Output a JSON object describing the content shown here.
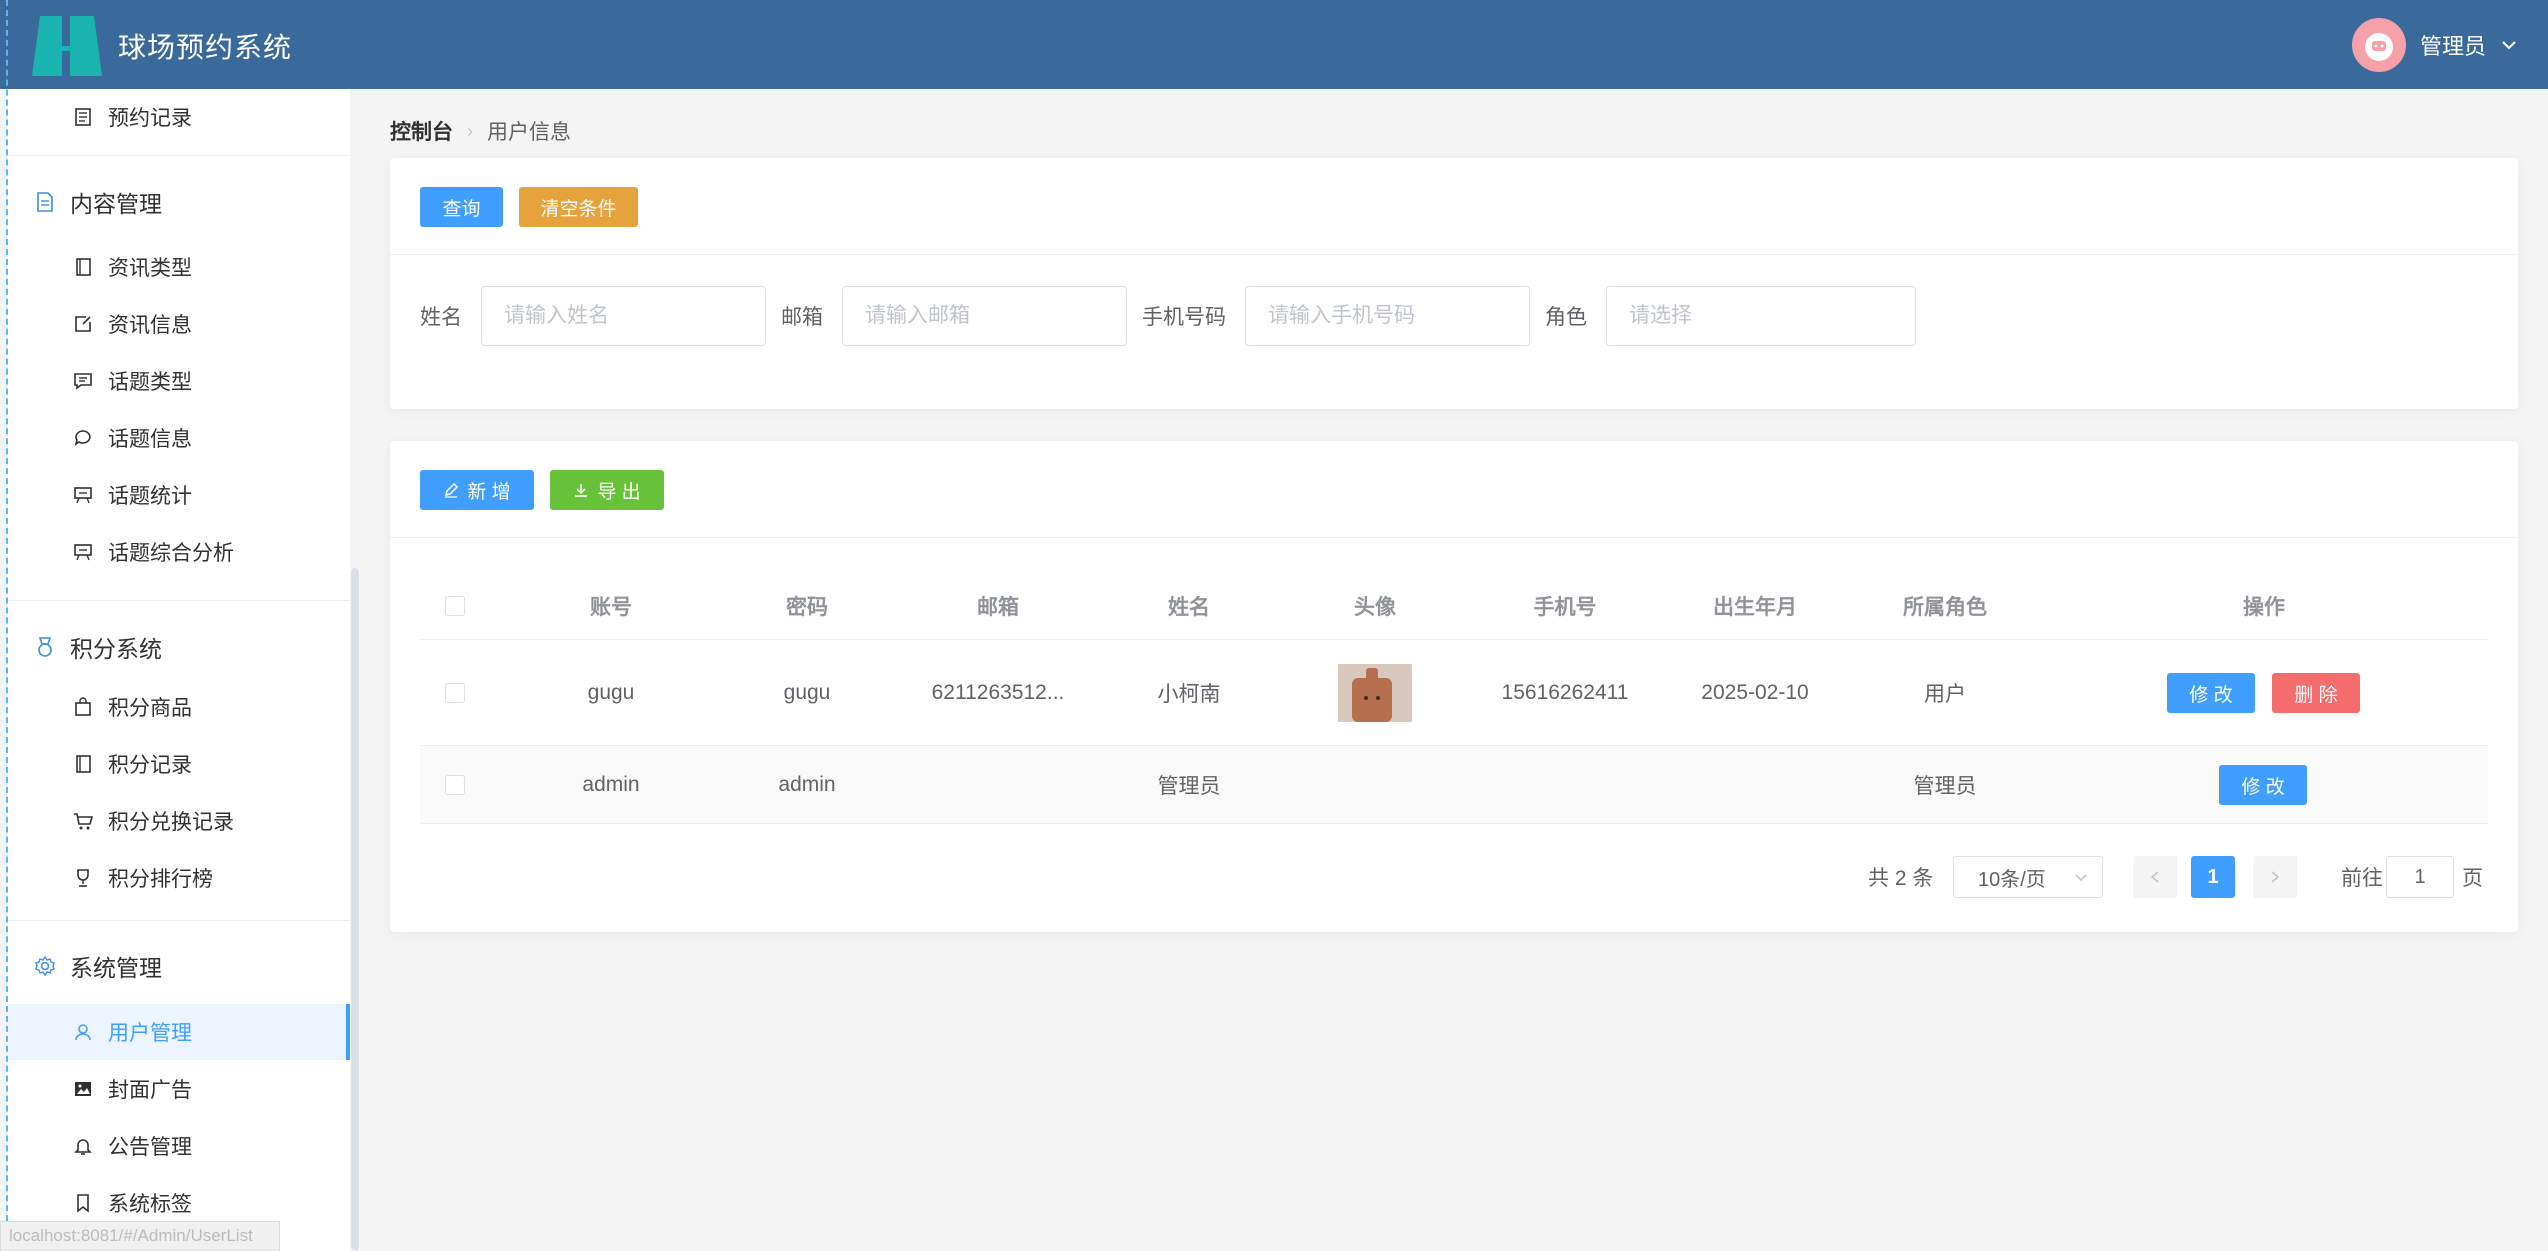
{
  "header": {
    "app_title": "球场预约系统",
    "user_label": "管理员"
  },
  "sidebar": {
    "items": [
      {
        "label": "预约记录",
        "icon": "document-icon"
      },
      {
        "label": "内容管理",
        "icon": "file-text-icon",
        "group": true
      },
      {
        "label": "资讯类型",
        "icon": "notebook-icon"
      },
      {
        "label": "资讯信息",
        "icon": "edit-doc-icon"
      },
      {
        "label": "话题类型",
        "icon": "chat-square-icon"
      },
      {
        "label": "话题信息",
        "icon": "chat-round-icon"
      },
      {
        "label": "话题统计",
        "icon": "presentation-icon"
      },
      {
        "label": "话题综合分析",
        "icon": "presentation-icon"
      },
      {
        "label": "积分系统",
        "icon": "medal-icon",
        "group": true
      },
      {
        "label": "积分商品",
        "icon": "shopping-bag-icon"
      },
      {
        "label": "积分记录",
        "icon": "notebook-icon"
      },
      {
        "label": "积分兑换记录",
        "icon": "cart-icon"
      },
      {
        "label": "积分排行榜",
        "icon": "trophy-icon"
      },
      {
        "label": "系统管理",
        "icon": "gear-icon",
        "group": true
      },
      {
        "label": "用户管理",
        "icon": "user-icon",
        "active": true
      },
      {
        "label": "封面广告",
        "icon": "picture-icon"
      },
      {
        "label": "公告管理",
        "icon": "bell-icon"
      },
      {
        "label": "系统标签",
        "icon": "bookmark-icon"
      }
    ],
    "status_url": "localhost:8081/#/Admin/UserList"
  },
  "breadcrumb": {
    "home": "控制台",
    "current": "用户信息"
  },
  "search": {
    "query_label": "查询",
    "clear_label": "清空条件",
    "name_label": "姓名",
    "name_placeholder": "请输入姓名",
    "email_label": "邮箱",
    "email_placeholder": "请输入邮箱",
    "phone_label": "手机号码",
    "phone_placeholder": "请输入手机号码",
    "role_label": "角色",
    "role_placeholder": "请选择"
  },
  "toolbar": {
    "add_label": "新 增",
    "export_label": "导 出"
  },
  "table": {
    "headers": [
      "账号",
      "密码",
      "邮箱",
      "姓名",
      "头像",
      "手机号",
      "出生年月",
      "所属角色",
      "操作"
    ],
    "rows": [
      {
        "account": "gugu",
        "password": "gugu",
        "email": "6211263512...",
        "name": "小柯南",
        "has_avatar": true,
        "phone": "15616262411",
        "birth": "2025-02-10",
        "role": "用户",
        "edit": "修 改",
        "delete": "删 除"
      },
      {
        "account": "admin",
        "password": "admin",
        "email": "",
        "name": "管理员",
        "has_avatar": false,
        "phone": "",
        "birth": "",
        "role": "管理员",
        "edit": "修 改"
      }
    ]
  },
  "pagination": {
    "total_label": "共 2 条",
    "page_size": "10条/页",
    "current_page": "1",
    "goto_prefix": "前往",
    "goto_value": "1",
    "goto_suffix": "页"
  },
  "colors": {
    "header_bg": "#3a6a9c",
    "primary": "#409eff",
    "warning": "#e6a23c",
    "success": "#67c23a",
    "danger": "#f56c6c"
  }
}
